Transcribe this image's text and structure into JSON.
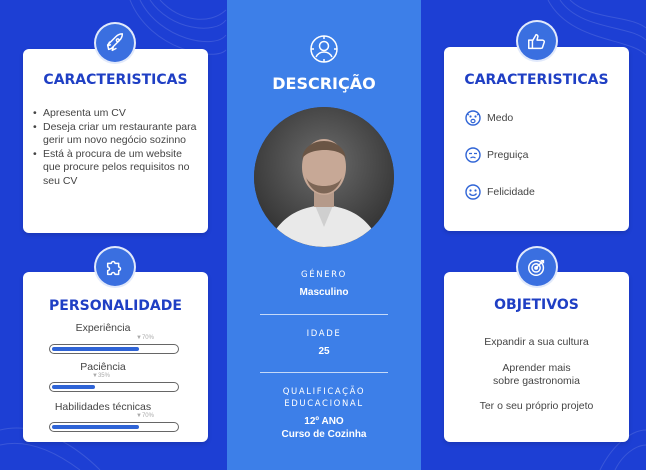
{
  "colors": {
    "background": "#1d3fd4",
    "center_column": "#3d7fe8",
    "title": "#1f3fc4",
    "bar_fill": "#2f64d6"
  },
  "left_top": {
    "title": "CARACTERISTICAS",
    "icon": "rocket-icon",
    "items": [
      "Apresenta um CV",
      "Deseja criar um restaurante para gerir um novo negócio sozinno",
      "Está à procura de um website que procure pelos requisitos no seu CV"
    ]
  },
  "personality": {
    "title": "PERSONALIDADE",
    "icon": "puzzle-icon",
    "skills": [
      {
        "label": "Experiência",
        "pct_label": "70%",
        "value": 0.7
      },
      {
        "label": "Paciência",
        "pct_label": "35%",
        "value": 0.35
      },
      {
        "label": "Habilidades técnicas",
        "pct_label": "70%",
        "value": 0.7
      }
    ]
  },
  "center": {
    "title": "DESCRIÇÃO",
    "icon": "person-icon",
    "gender_label": "GÉNERO",
    "gender_value": "Masculino",
    "age_label": "IDADE",
    "age_value": "25",
    "edu_label_1": "QUALIFICAÇÃO",
    "edu_label_2": "EDUCACIONAL",
    "edu_value_1": "12º ANO",
    "edu_value_2": "Curso de Cozinha"
  },
  "right_top": {
    "title": "CARACTERISTICAS",
    "icon": "thumbs-up-icon",
    "traits": [
      {
        "label": "Medo",
        "icon": "fear-face-icon"
      },
      {
        "label": "Preguiça",
        "icon": "lazy-face-icon"
      },
      {
        "label": "Felicidade",
        "icon": "happy-face-icon"
      }
    ]
  },
  "goals": {
    "title": "OBJETIVOS",
    "icon": "target-icon",
    "items": [
      "Expandir a sua cultura",
      "Aprender mais sobre gastronomia",
      "Ter o seu próprio projeto"
    ]
  }
}
